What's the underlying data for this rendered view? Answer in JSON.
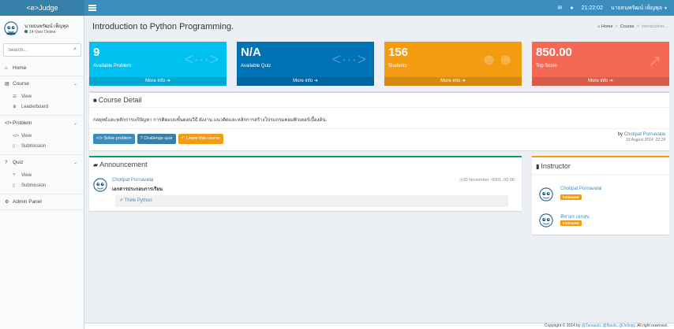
{
  "app": {
    "logo": "<e>Judge"
  },
  "topbar": {
    "time": "21:22:02",
    "user_name": "นายธนพรัฒน์ เพ็ญพุล"
  },
  "sidebar": {
    "user_name": "นายธนพรัฒน์ เพ็ญพุล",
    "user_status": "14 User Online",
    "search_placeholder": "Search...",
    "home": "Home",
    "course": {
      "label": "Course",
      "items": [
        "View",
        "Leaderboard"
      ]
    },
    "problem": {
      "label": "Problem",
      "items": [
        "View",
        "Submission"
      ]
    },
    "quiz": {
      "label": "Quiz",
      "items": [
        "View",
        "Submission"
      ]
    },
    "admin": "Admin Panel"
  },
  "page": {
    "title": "Introduction to Python Programming.",
    "breadcrumb": [
      "Home",
      "Course",
      "Introduction..."
    ]
  },
  "tiles": [
    {
      "value": "9",
      "label": "Available Problem",
      "more": "More info",
      "color": "#00c0ef",
      "icon": "code-icon"
    },
    {
      "value": "N/A",
      "label": "Available Quiz",
      "more": "More info",
      "color": "#0073b7",
      "icon": "code-icon"
    },
    {
      "value": "156",
      "label": "Students",
      "more": "More info",
      "color": "#f39c12",
      "icon": "users-icon"
    },
    {
      "value": "850.00",
      "label": "Top Score",
      "more": "More info",
      "color": "#f56954",
      "icon": "chart-icon"
    }
  ],
  "course_detail": {
    "title": "Course Detail",
    "description": "กลยุทธ์และหลักการแก้ปัญหา การคิดแบบขั้นตอนวิธี ผังงาน แนวคิดและหลักการสร้างโปรแกรมคอมพิวเตอร์เบื้องต้น.",
    "buttons": {
      "solve": "Solve problem",
      "challenge": "Challenge quiz",
      "leave": "Leave this course"
    },
    "by_prefix": "by",
    "author": "Chotipat Pornavalai",
    "date": "19 August 2014, 22:18"
  },
  "announcement": {
    "title": "Announcement",
    "author": "Chotipat Pornavalai",
    "date": "30 November -0001, 00:00",
    "heading": "เอกสารประกอบการเรียน",
    "link": "Think Python"
  },
  "instructor": {
    "title": "Instructor",
    "people": [
      {
        "name": "Chotipat Pornavalai",
        "role": "Instructor"
      },
      {
        "name": "พีชายร เอกสุน",
        "role": "Instructor"
      }
    ]
  },
  "footer": {
    "copyright": "Copyright © 2014 by",
    "authors": [
      "@Tanasab",
      "@Naoki",
      "@Jellopy"
    ],
    "rights": "All right reserved."
  }
}
